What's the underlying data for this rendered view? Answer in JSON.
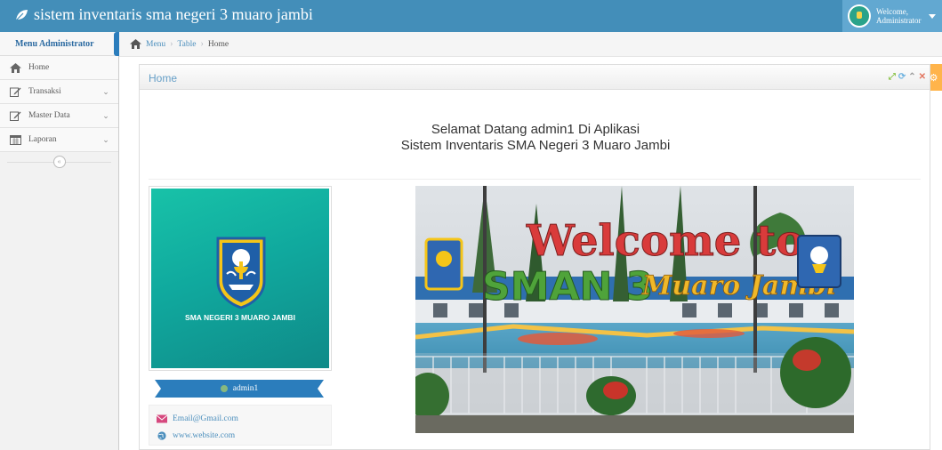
{
  "app": {
    "title": "sistem inventaris sma negeri 3 muaro jambi",
    "user_greeting": "Welcome,",
    "user_role": "Administrator"
  },
  "colors": {
    "navbar": "#438eb9",
    "accent": "#2b7dbc",
    "teal": "#12b39f",
    "settings": "#ffb44b"
  },
  "sidebar": {
    "header": "Menu Administrator",
    "items": [
      {
        "label": "Home",
        "icon": "home-icon",
        "has_submenu": false
      },
      {
        "label": "Transaksi",
        "icon": "edit-icon",
        "has_submenu": true
      },
      {
        "label": "Master Data",
        "icon": "edit-icon",
        "has_submenu": true
      },
      {
        "label": "Laporan",
        "icon": "calendar-icon",
        "has_submenu": true
      }
    ]
  },
  "breadcrumb": {
    "items": [
      "Menu",
      "Table",
      "Home"
    ]
  },
  "widget": {
    "title": "Home",
    "welcome_line1": "Selamat Datang admin1 Di Aplikasi",
    "welcome_line2": "Sistem Inventaris SMA Negeri 3 Muaro Jambi"
  },
  "profile": {
    "school_name": "SMA NEGERI 3 MUARO JAMBI",
    "username": "admin1",
    "email": "Email@Gmail.com",
    "website": "www.website.com"
  },
  "photo": {
    "sign_word1": "Welcome to",
    "sign_word2": "SMAN 3",
    "sign_word3": "Muaro Jambi"
  }
}
